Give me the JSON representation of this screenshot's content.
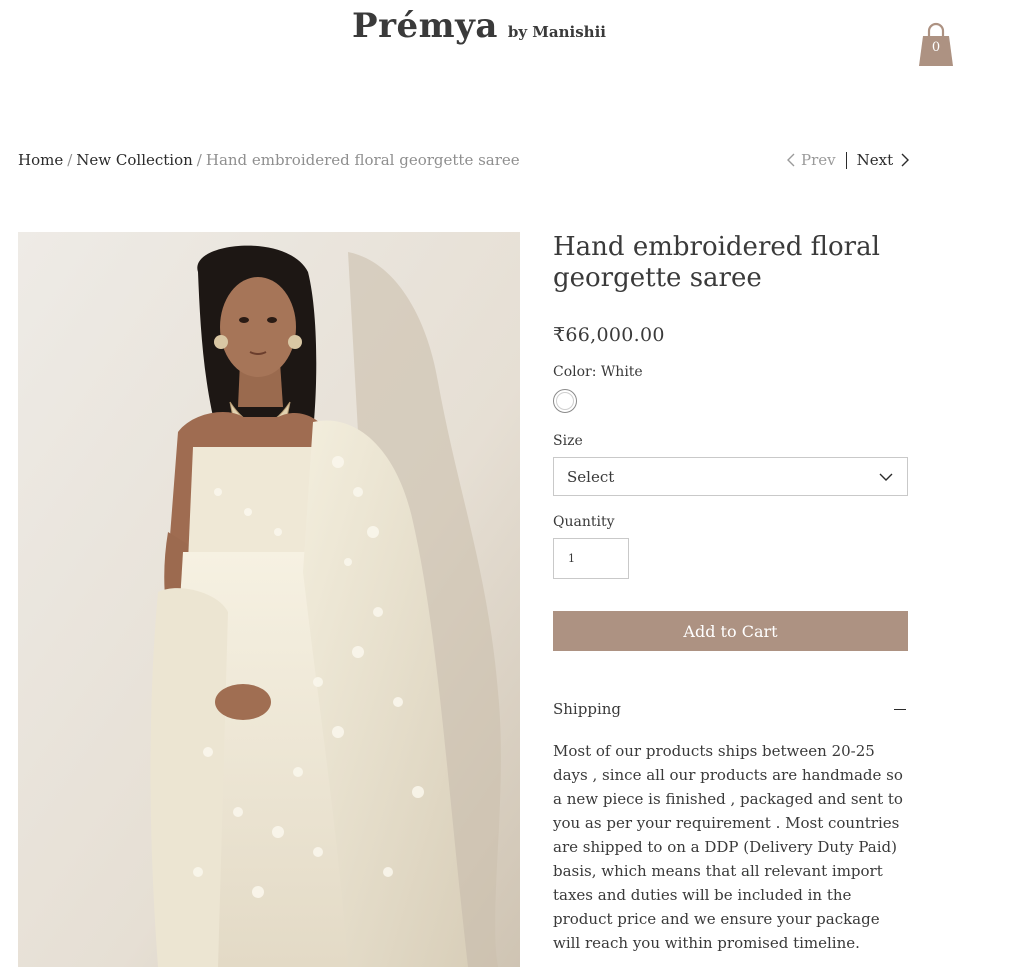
{
  "header": {
    "brand_name": "Prémya",
    "brand_by": "by Manishii",
    "cart_count": "0"
  },
  "breadcrumb": {
    "home": "Home",
    "separator": "/",
    "collection": "New Collection",
    "current": "Hand embroidered floral georgette saree"
  },
  "pager": {
    "prev": "Prev",
    "next": "Next"
  },
  "product": {
    "title": "Hand embroidered floral georgette saree",
    "price": "₹66,000.00",
    "color_label": "Color: White",
    "color_swatches": [
      "#ffffff"
    ],
    "size_label": "Size",
    "size_value": "Select",
    "quantity_label": "Quantity",
    "quantity_value": "1",
    "add_to_cart": "Add to Cart",
    "shipping_title": "Shipping",
    "shipping_text": "Most of our products ships between 20-25 days , since all our products are handmade so a new piece is finished , packaged and sent to you as per your requirement . Most countries are shipped to on a DDP (Delivery Duty Paid) basis, which means that all relevant import taxes and duties will be included in the product price and we ensure your package will reach you within promised timeline."
  },
  "colors": {
    "accent": "#ad9282",
    "text": "#3a3a3a",
    "muted": "#8f8f8f"
  },
  "icons": {
    "cart": "shopping-bag-icon",
    "prev": "chevron-left-icon",
    "next": "chevron-right-icon",
    "dropdown": "chevron-down-icon",
    "collapse": "minus-icon"
  }
}
